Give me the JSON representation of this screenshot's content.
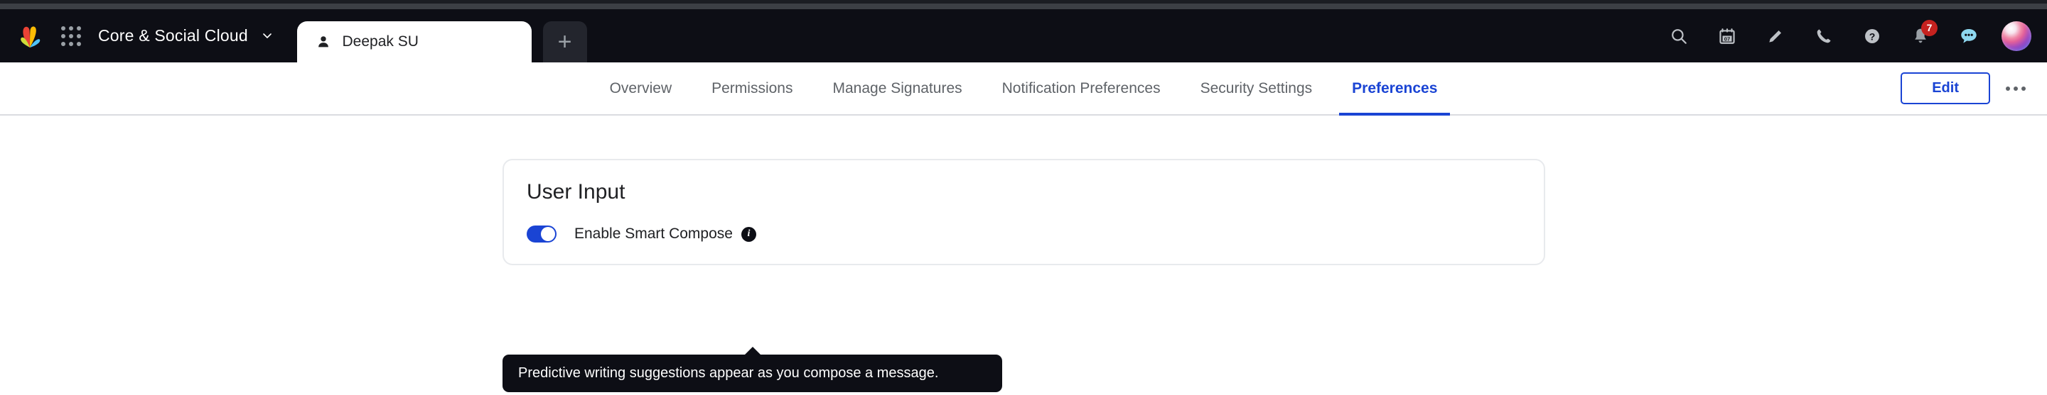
{
  "window": {
    "chrome_strip_color": "#3c3f45"
  },
  "appbar": {
    "background_color": "#0d0e15",
    "logo_name": "brand-logo",
    "app_launcher_name": "apps-grid-icon",
    "org_name": "Core & Social Cloud",
    "org_caret": "˅",
    "tabs": [
      {
        "label": "Deepak SU",
        "icon": "person-icon",
        "active": true
      }
    ],
    "new_tab_label": "+",
    "icons": [
      {
        "name": "search-icon",
        "label": "Search"
      },
      {
        "name": "calendar-icon",
        "label": "Calendar",
        "day": "07"
      },
      {
        "name": "pencil-icon",
        "label": "Compose"
      },
      {
        "name": "phone-icon",
        "label": "Call"
      },
      {
        "name": "help-icon",
        "label": "Help"
      },
      {
        "name": "bell-icon",
        "label": "Notifications",
        "badge": "7",
        "badge_color": "#c5221f"
      },
      {
        "name": "chat-icon",
        "label": "Chat",
        "color": "#8ed8f0"
      },
      {
        "name": "avatar",
        "label": "Account"
      }
    ]
  },
  "navbar": {
    "accent_color": "#1a44d4",
    "tabs": [
      {
        "label": "Overview",
        "active": false
      },
      {
        "label": "Permissions",
        "active": false
      },
      {
        "label": "Manage Signatures",
        "active": false
      },
      {
        "label": "Notification Preferences",
        "active": false
      },
      {
        "label": "Security Settings",
        "active": false
      },
      {
        "label": "Preferences",
        "active": true
      }
    ],
    "edit_label": "Edit",
    "more_label": "More options"
  },
  "card": {
    "title": "User Input",
    "setting": {
      "label": "Enable Smart Compose",
      "toggle_on": true,
      "toggle_color": "#1a44d4",
      "info_glyph": "i"
    }
  },
  "tooltip": {
    "text": "Predictive writing suggestions appear as you compose a message.",
    "background_color": "#0d0e15"
  }
}
